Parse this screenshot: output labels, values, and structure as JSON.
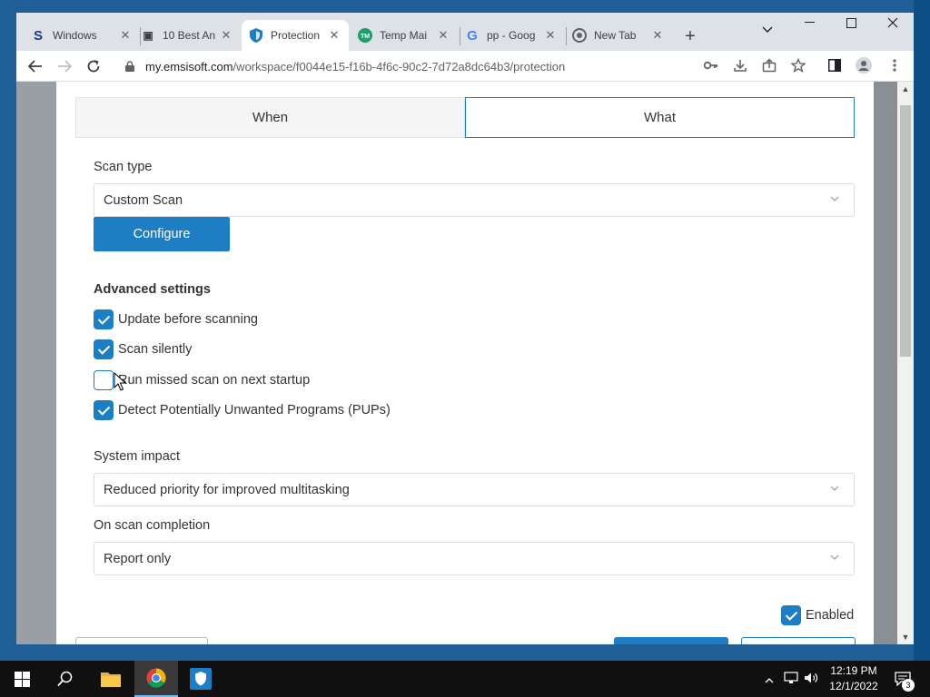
{
  "browser": {
    "tabs": [
      {
        "title": "Windows",
        "icon": "s-logo-icon",
        "favicon_text": "S",
        "favicon_color": "#1a3a8f",
        "active": false
      },
      {
        "title": "10 Best An",
        "icon": "robot-icon",
        "favicon_text": "▣",
        "favicon_color": "#202124",
        "active": false
      },
      {
        "title": "Protection",
        "icon": "emsisoft-shield-icon",
        "favicon_text": "⛉",
        "favicon_color": "#1e7ec3",
        "active": true
      },
      {
        "title": "Temp Mai",
        "icon": "tempmail-icon",
        "favicon_text": "●",
        "favicon_color": "#1e9e6a",
        "active": false
      },
      {
        "title": "pp - Goog",
        "icon": "google-icon",
        "favicon_text": "G",
        "favicon_color": "#4285f4",
        "active": false
      },
      {
        "title": "New Tab",
        "icon": "chrome-icon",
        "favicon_text": "◎",
        "favicon_color": "#5f6368",
        "active": false
      }
    ],
    "new_tab_label": "+",
    "url_host": "my.emsisoft.com",
    "url_path": "/workspace/f0044e15-f16b-4f6c-90c2-7d72a8dc64b3/protection"
  },
  "dialog": {
    "tabs": {
      "when": "When",
      "what": "What"
    },
    "scan_type": {
      "label": "Scan type",
      "value": "Custom Scan"
    },
    "configure_label": "Configure",
    "advanced": {
      "heading": "Advanced settings",
      "options": [
        {
          "label": "Update before scanning",
          "checked": true
        },
        {
          "label": "Scan silently",
          "checked": true
        },
        {
          "label": "Run missed scan on next startup",
          "checked": false
        },
        {
          "label": "Detect Potentially Unwanted Programs (PUPs)",
          "checked": true
        }
      ]
    },
    "system_impact": {
      "label": "System impact",
      "value": "Reduced priority for improved multitasking"
    },
    "on_completion": {
      "label": "On scan completion",
      "value": "Report only"
    },
    "enabled": {
      "label": "Enabled",
      "checked": true
    }
  },
  "taskbar": {
    "time": "12:19 PM",
    "date": "12/1/2022",
    "notification_count": "3"
  },
  "colors": {
    "accent": "#1e7ec3"
  }
}
